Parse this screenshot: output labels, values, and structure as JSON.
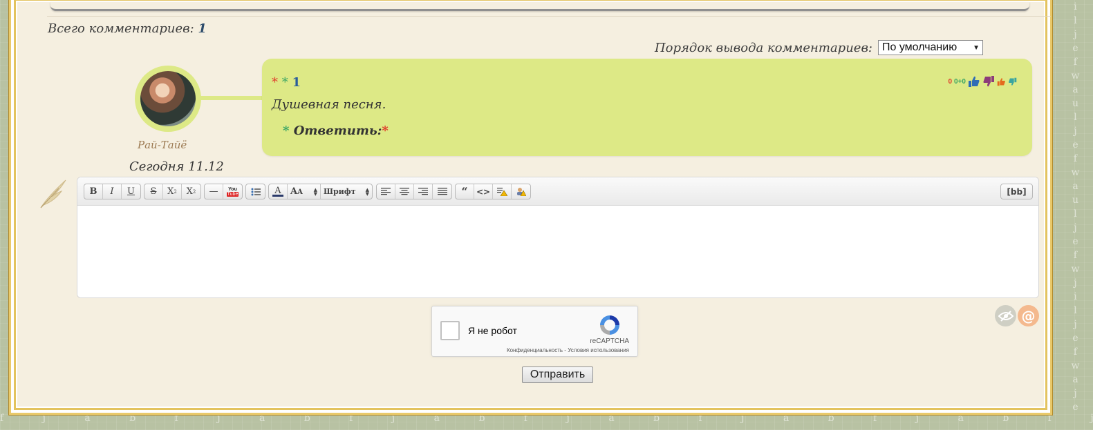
{
  "comments": {
    "total_label": "Всего комментариев:",
    "total_count": "1",
    "order_label": "Порядок вывода комментариев:",
    "order_value": "По умолчанию"
  },
  "comment": {
    "username": "Рай-Тайё",
    "date": "Сегодня 11.12",
    "number": "1",
    "text": "Душевная песня.",
    "reply_label": "Ответить:",
    "rating": "0",
    "rating_delta": "0+0"
  },
  "editor": {
    "font_select": "Шрифт",
    "bb_label": "[bb]",
    "youtube_top": "You",
    "youtube_bottom": "Tube"
  },
  "captcha": {
    "label": "Я не робот",
    "brand": "reCAPTCHA",
    "links": "Конфиденциальность - Условия использования"
  },
  "submit_label": "Отправить",
  "colors": {
    "bubble": "#dde986",
    "page_bg": "#f5efe0",
    "frame_gold": "#e3c35e"
  },
  "icons": [
    "bold-icon",
    "italic-icon",
    "underline-icon",
    "strike-icon",
    "superscript-icon",
    "subscript-icon",
    "hr-icon",
    "youtube-icon",
    "list-icon",
    "text-color-icon",
    "font-size-icon",
    "align-left-icon",
    "align-center-icon",
    "align-right-icon",
    "align-justify-icon",
    "quote-icon",
    "code-icon",
    "spoiler-icon",
    "hide-icon",
    "thumbs-up-icon",
    "thumbs-down-icon",
    "eye-icon",
    "at-icon",
    "recaptcha-logo-icon",
    "feather-icon"
  ]
}
